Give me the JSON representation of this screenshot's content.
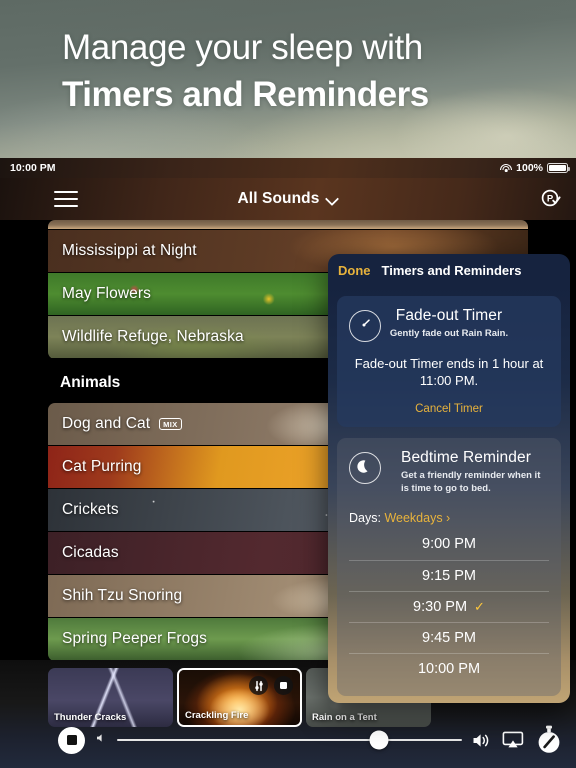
{
  "promo": {
    "line1": "Manage your sleep with",
    "line2": "Timers and Reminders"
  },
  "statusbar": {
    "time": "10:00 PM",
    "battery_percent": "100%",
    "wifi_icon": "wifi-icon",
    "battery_icon": "battery-full-icon"
  },
  "navbar": {
    "menu_icon": "hamburger-menu-icon",
    "title": "All Sounds",
    "chevron_icon": "chevron-down-icon",
    "pro_icon": "pro-badge-icon"
  },
  "sound_list": {
    "top_rows": [
      {
        "label": "",
        "badge": ""
      },
      {
        "label": "Mississippi at Night",
        "badge": ""
      },
      {
        "label": "May Flowers",
        "badge": ""
      },
      {
        "label": "Wildlife Refuge, Nebraska",
        "badge": ""
      }
    ],
    "section_title": "Animals",
    "animal_rows": [
      {
        "label": "Dog and Cat",
        "badge": "MIX"
      },
      {
        "label": "Cat Purring",
        "badge": ""
      },
      {
        "label": "Crickets",
        "badge": ""
      },
      {
        "label": "Cicadas",
        "badge": ""
      },
      {
        "label": "Shih Tzu Snoring",
        "badge": ""
      },
      {
        "label": "Spring Peeper Frogs",
        "badge": ""
      }
    ]
  },
  "panel": {
    "done_label": "Done",
    "title": "Timers and Reminders",
    "fade_card": {
      "icon": "timer-icon",
      "heading": "Fade-out Timer",
      "subtitle": "Gently fade out Rain Rain.",
      "status": "Fade-out Timer ends in 1 hour at 11:00 PM.",
      "cancel_label": "Cancel Timer"
    },
    "bedtime_card": {
      "icon": "moon-icon",
      "heading": "Bedtime Reminder",
      "subtitle": "Get a friendly reminder when it is time to go to bed.",
      "days_label": "Days:",
      "days_value": "Weekdays ›",
      "times": [
        {
          "label": "9:00 PM",
          "selected": false
        },
        {
          "label": "9:15 PM",
          "selected": false
        },
        {
          "label": "9:30 PM",
          "selected": true
        },
        {
          "label": "9:45 PM",
          "selected": false
        },
        {
          "label": "10:00 PM",
          "selected": false
        }
      ],
      "check_glyph": "✓"
    }
  },
  "player": {
    "tiles": [
      {
        "name": "Thunder Cracks",
        "selected": false
      },
      {
        "name": "Crackling Fire",
        "selected": true
      },
      {
        "name": "Rain on a Tent",
        "selected": false
      }
    ],
    "tile_mixer_icon": "mixer-sliders-icon",
    "tile_stop_icon": "stop-icon",
    "stop_icon": "stop-button",
    "volume_low_icon": "speaker-low-icon",
    "volume_icon": "speaker-waves-icon",
    "airplay_icon": "airplay-icon",
    "timer_icon": "stopwatch-icon",
    "volume_percent": 76
  },
  "colors": {
    "accent_gold": "#e8b33c",
    "panel_header": "#16233f",
    "check_gold": "#ffc83c"
  }
}
